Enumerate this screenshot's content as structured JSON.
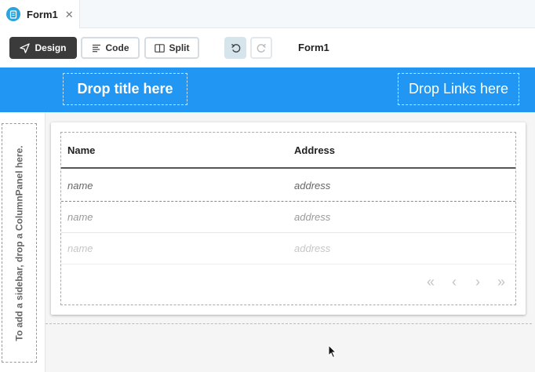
{
  "tab": {
    "label": "Form1",
    "close": "✕",
    "icon": "form-icon"
  },
  "toolbar": {
    "design_label": "Design",
    "code_label": "Code",
    "split_label": "Split",
    "form_name": "Form1"
  },
  "header": {
    "title_placeholder": "Drop title here",
    "links_placeholder": "Drop Links here",
    "color": "#2196f3"
  },
  "sidebar": {
    "placeholder": "To add a sidebar, drop a ColumnPanel here."
  },
  "grid": {
    "columns": [
      "Name",
      "Address"
    ],
    "rows": [
      {
        "name": "name",
        "address": "address"
      },
      {
        "name": "name",
        "address": "address"
      },
      {
        "name": "name",
        "address": "address"
      }
    ],
    "pager": [
      "«",
      "‹",
      "›",
      "»"
    ]
  }
}
